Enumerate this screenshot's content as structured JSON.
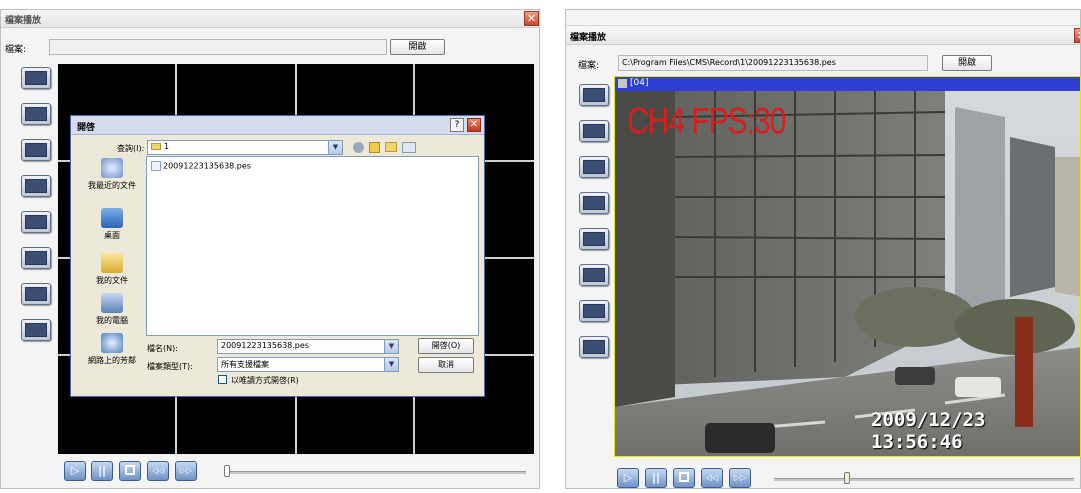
{
  "left_window": {
    "title": "檔案播放",
    "file_label": "檔案:",
    "file_value": "",
    "open_button": "開啟",
    "close_glyph": "✕"
  },
  "dialog": {
    "title": "開啓",
    "help_glyph": "?",
    "close_glyph": "✕",
    "lookin_label": "查詢(I):",
    "lookin_value": "1",
    "dropdown_glyph": "▼",
    "file_item": "20091223135638.pes",
    "places": [
      {
        "label": "我最近的文件",
        "icon": "recent-documents-icon"
      },
      {
        "label": "桌面",
        "icon": "desktop-icon"
      },
      {
        "label": "我的文件",
        "icon": "my-documents-icon"
      },
      {
        "label": "我的電腦",
        "icon": "my-computer-icon"
      },
      {
        "label": "網路上的芳鄰",
        "icon": "network-places-icon"
      }
    ],
    "filename_label": "檔名(N):",
    "filename_value": "20091223135638.pes",
    "filetype_label": "檔案類型(T):",
    "filetype_value": "所有支援檔案",
    "readonly_label": "以唯讀方式開啓(R)",
    "open_button": "開啓(O)",
    "cancel_button": "取消"
  },
  "right_window": {
    "title": "檔案播放",
    "file_label": "檔案:",
    "file_value": "C:\\Program Files\\CMS\\Record\\1\\20091223135638.pes",
    "open_button": "開啟",
    "close_glyph": "✕",
    "video_channel_tag": "[04]",
    "video_overlay": "CH4 FPS:30",
    "video_timestamp": "2009/12/23 13:56:46"
  },
  "layout_buttons": [
    "layout-1x1",
    "layout-2x2",
    "layout-3x3",
    "layout-4x4",
    "layout-1plus5",
    "layout-1plus7",
    "layout-1plus9",
    "layout-1plus12"
  ],
  "playback": {
    "play": "▷",
    "pause": "||",
    "stop": "□",
    "rewind": "◁◁",
    "forward": "▷▷"
  },
  "progress": {
    "left": 0.0,
    "right": 0.12
  },
  "colors": {
    "dialog_title": "#d5dced",
    "overlay_red": "#d81d1d",
    "channel_bar": "#2e3fd8"
  }
}
